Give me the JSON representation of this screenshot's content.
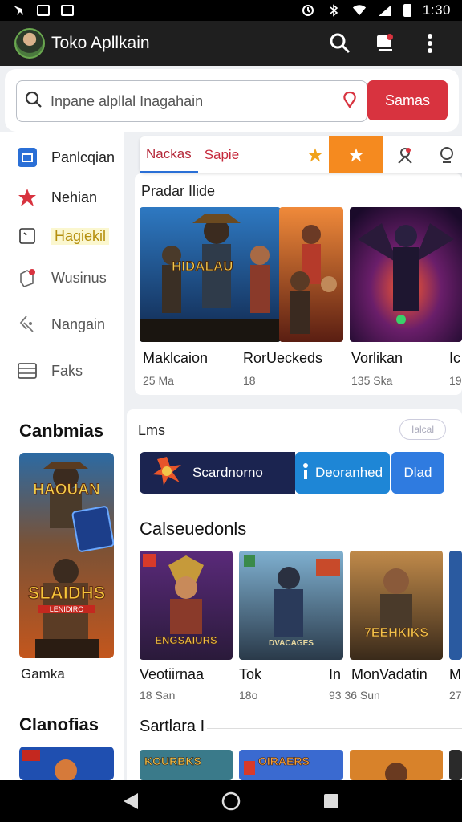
{
  "status_bar": {
    "time": "1:30"
  },
  "app_bar": {
    "title": "Toko Apllkain"
  },
  "search": {
    "placeholder": "Inpane alpllal Inagahain",
    "button_label": "Samas"
  },
  "sidebar": {
    "items": [
      {
        "label": "Panlcqian",
        "icon": "calendar-icon"
      },
      {
        "label": "Nehian",
        "icon": "star-icon"
      },
      {
        "label": "Hagiekil",
        "icon": "document-icon"
      },
      {
        "label": "Wusinus",
        "icon": "notification-icon"
      },
      {
        "label": "Nangain",
        "icon": "tag-icon"
      },
      {
        "label": "Faks",
        "icon": "list-icon"
      }
    ],
    "section1_heading": "Canbmias",
    "section1_caption": "Gamka",
    "section2_heading": "Clanofias",
    "thumb1_title": "HAOUAN",
    "thumb2_title": "SLAIDHS",
    "thumb2_sub": "LENIDIRO"
  },
  "tabs": [
    {
      "label": "Nackas"
    },
    {
      "label": "Sapie"
    }
  ],
  "featured": {
    "title": "Pradar Ilide",
    "games": [
      {
        "name": "Maklcaion",
        "size": "25 Ma",
        "art_text": "HIDALAU"
      },
      {
        "name": "RorUeckeds",
        "size": "18",
        "art_text": ""
      },
      {
        "name": "Vorlikan",
        "size": "135 Ska",
        "art_text": ""
      },
      {
        "name": "Ic",
        "size": "19"
      }
    ]
  },
  "lms": {
    "title": "Lms",
    "pill": "Ialcal",
    "promo_label": "Scardnorno",
    "btn1": "Deoranhed",
    "btn2": "Dlad"
  },
  "categories": {
    "title": "Calseuedonls",
    "games": [
      {
        "name": "Veotiirnaa",
        "size": "18 San",
        "art_text": "ENGSAIURS"
      },
      {
        "name": "Tok",
        "size": "18o",
        "art_text": "DVACAGES"
      },
      {
        "name": "MonVadatin",
        "size": "93 36 Sun",
        "prefix": "In",
        "art_text": "7EEHKIKS"
      },
      {
        "name": "M",
        "size": "27"
      }
    ]
  },
  "section3": {
    "title": "Sartlara I",
    "games": [
      {
        "art_text": "KOURBKS"
      },
      {
        "art_text": "OIRAERS"
      },
      {
        "art_text": ""
      }
    ]
  },
  "colors": {
    "accent_red": "#d8333f",
    "app_bar": "#1f1f1f",
    "orange": "#f58a1f",
    "blue": "#1e86d6"
  }
}
